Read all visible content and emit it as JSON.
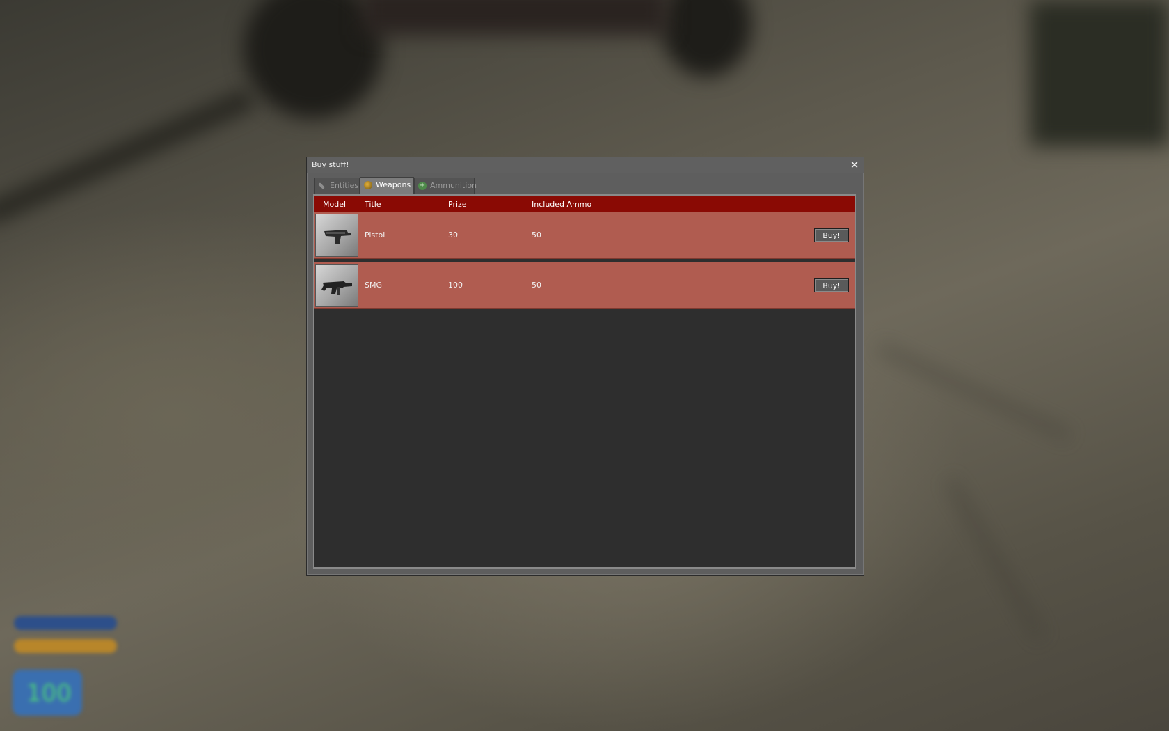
{
  "window": {
    "title": "Buy stuff!",
    "close_icon": "close-icon"
  },
  "tabs": [
    {
      "label": "Entities",
      "icon": "wrench-icon",
      "active": false
    },
    {
      "label": "Weapons",
      "icon": "grenade-icon",
      "active": true
    },
    {
      "label": "Ammunition",
      "icon": "plus-icon",
      "active": false
    }
  ],
  "table": {
    "columns": [
      "Model",
      "Title",
      "Prize",
      "Included Ammo"
    ],
    "rows": [
      {
        "title": "Pistol",
        "prize": "30",
        "ammo": "50",
        "buy_label": "Buy!",
        "model_icon": "pistol-icon"
      },
      {
        "title": "SMG",
        "prize": "100",
        "ammo": "50",
        "buy_label": "Buy!",
        "model_icon": "smg-icon"
      }
    ]
  },
  "hud": {
    "health": "100"
  },
  "colors": {
    "header": "#8a0a04",
    "row": "#b05c50",
    "panel": "#2e2e2e",
    "window": "#5e5e5e"
  }
}
